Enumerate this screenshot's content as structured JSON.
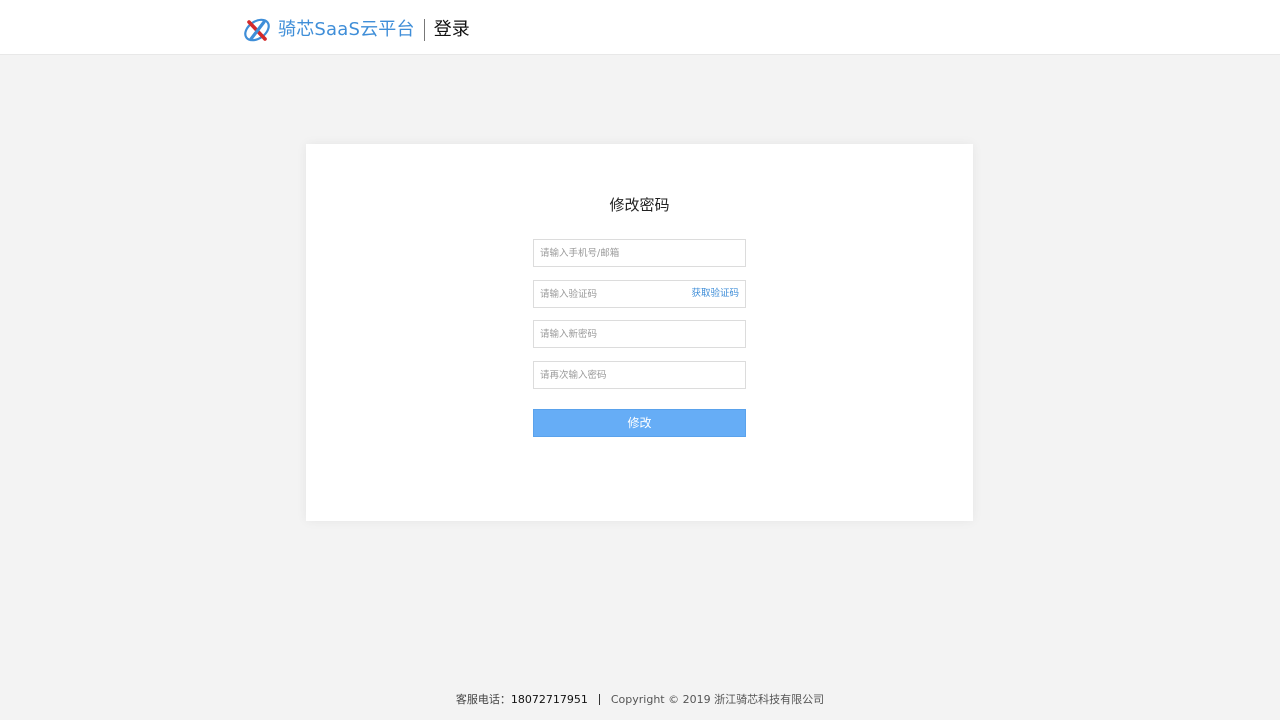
{
  "header": {
    "brand": "骑芯SaaS云平台",
    "title": "登录",
    "logo_icon": "x-orbit-logo-icon",
    "brand_color": "#3f8ed8"
  },
  "form": {
    "title": "修改密码",
    "account_placeholder": "请输入手机号/邮箱",
    "code_placeholder": "请输入验证码",
    "get_code_label": "获取验证码",
    "new_password_placeholder": "请输入新密码",
    "confirm_password_placeholder": "请再次输入密码",
    "submit_label": "修改",
    "button_color": "#66adf6"
  },
  "footer": {
    "phone_label": "客服电话：",
    "phone_number": "18072717951",
    "copyright": "Copyright © 2019 浙江骑芯科技有限公司"
  }
}
